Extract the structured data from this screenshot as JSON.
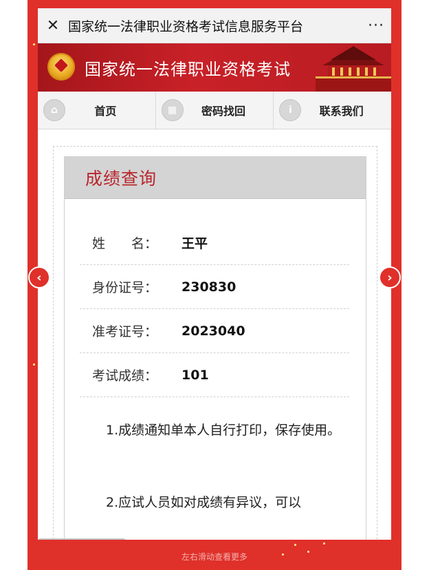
{
  "titlebar": {
    "close_icon": "close-icon",
    "title": "国家统一法律职业资格考试信息服务平台",
    "more_icon": "more-icon"
  },
  "banner": {
    "title": "国家统一法律职业资格考试",
    "emblem": "national-emblem-icon",
    "image": "tiananmen-gate"
  },
  "nav": {
    "items": [
      {
        "label": "首页",
        "icon": "home-icon"
      },
      {
        "label": "密码找回",
        "icon": "grid-icon"
      },
      {
        "label": "联系我们",
        "icon": "info-icon"
      }
    ]
  },
  "panel": {
    "title": "成绩查询",
    "rows": [
      {
        "label": "姓　　名：",
        "value": "王平"
      },
      {
        "label": "身份证号：",
        "value": "230830"
      },
      {
        "label": "准考证号：",
        "value": "2023040"
      },
      {
        "label": "考试成绩：",
        "value": "101"
      }
    ],
    "notes": [
      "1.成绩通知单本人自行打印，保存使用。",
      "2.应试人员如对成绩有异议，可以"
    ]
  },
  "carousel": {
    "prev_icon": "chevron-left-icon",
    "next_icon": "chevron-right-icon",
    "hint": "左右滑动查看更多"
  },
  "colors": {
    "frame": "#e0302a",
    "banner": "#c92128",
    "panel_title": "#b8252b"
  }
}
